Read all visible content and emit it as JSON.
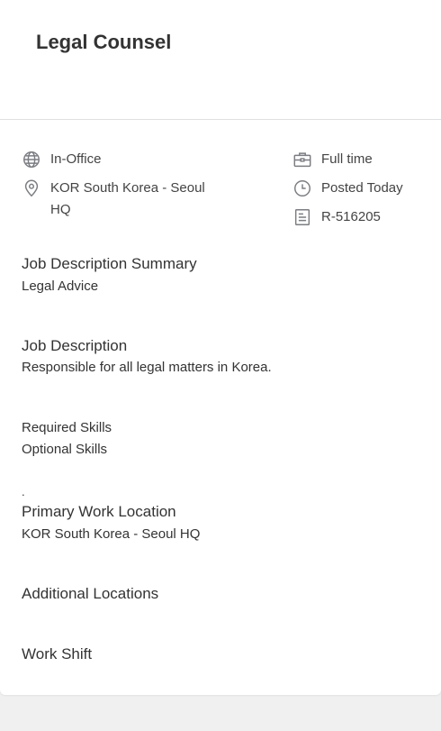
{
  "job": {
    "title": "Legal Counsel"
  },
  "meta": {
    "work_mode": "In-Office",
    "location": "KOR South Korea - Seoul HQ",
    "time_type": "Full time",
    "posted": "Posted Today",
    "req_id": "R-516205"
  },
  "icons": {
    "work_mode": "globe-icon",
    "location": "map-pin-icon",
    "time_type": "briefcase-icon",
    "posted": "clock-icon",
    "req_id": "document-icon"
  },
  "sections": {
    "summary_heading": "Job Description Summary",
    "summary_text": "Legal Advice",
    "description_heading": "Job Description",
    "description_text": "Responsible for all legal matters in Korea.",
    "required_skills": "Required Skills",
    "optional_skills": "Optional Skills",
    "separator": ".",
    "primary_location_heading": "Primary Work Location",
    "primary_location_text": "KOR South Korea - Seoul HQ",
    "additional_locations_heading": "Additional Locations",
    "work_shift_heading": "Work Shift"
  },
  "colors": {
    "page_background": "#f0f0f0",
    "card_background": "#ffffff",
    "text": "#333333",
    "icon": "#7b7d82",
    "divider": "#dfe0e2"
  }
}
